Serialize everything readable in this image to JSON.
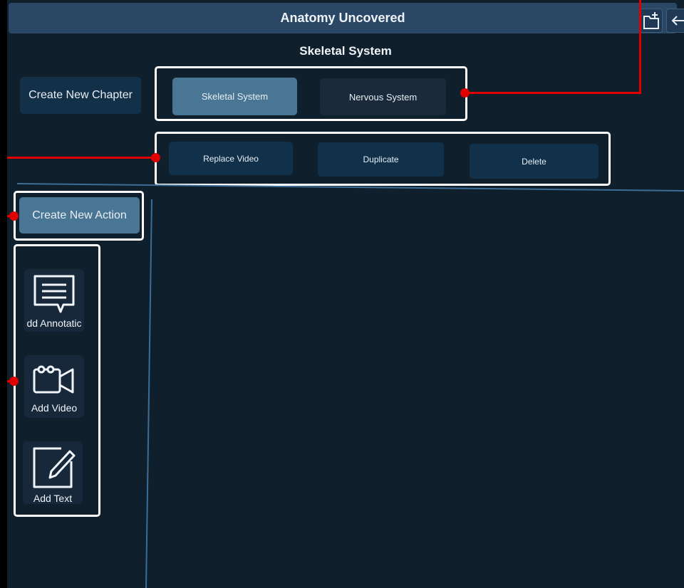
{
  "app": {
    "title": "Anatomy Uncovered"
  },
  "header": {
    "subtitle": "Skeletal System"
  },
  "chapters": {
    "create_label": "Create New Chapter",
    "items": [
      {
        "label": "Skeletal System",
        "selected": true
      },
      {
        "label": "Nervous System",
        "selected": false
      }
    ]
  },
  "video_actions": {
    "replace_label": "Replace Video",
    "duplicate_label": "Duplicate",
    "delete_label": "Delete"
  },
  "actions": {
    "create_label": "Create New Action"
  },
  "tools": [
    {
      "label": "dd Annotatic",
      "icon": "annotation-icon"
    },
    {
      "label": "Add Video",
      "icon": "video-camera-icon"
    },
    {
      "label": "Add Text",
      "icon": "edit-text-icon"
    }
  ],
  "colors": {
    "background": "#0f1f2c",
    "titlebar": "#2a4866",
    "selected_chapter": "#4a7696",
    "unselected_chapter": "#1b2a3b",
    "action_button": "#113049",
    "callout": "#e00000",
    "divider": "#3d6e97"
  }
}
